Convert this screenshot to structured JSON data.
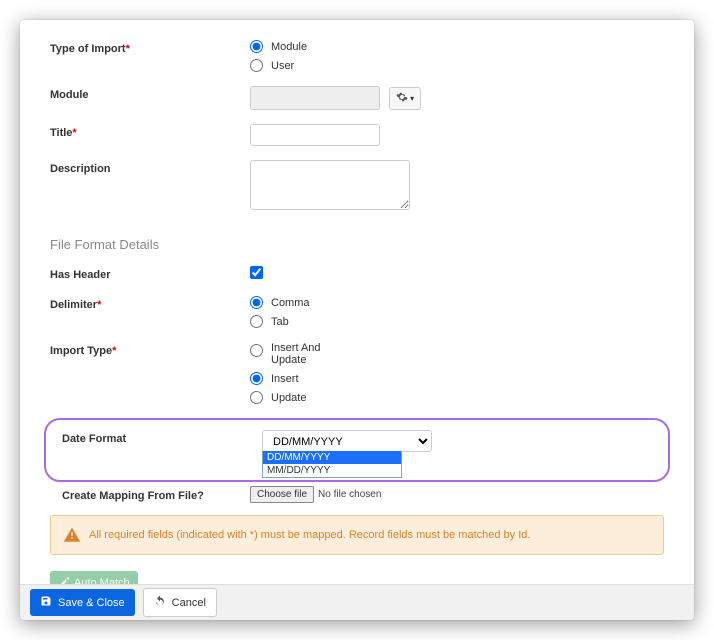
{
  "form": {
    "typeOfImport": {
      "label": "Type of Import",
      "required": true,
      "options": {
        "module": "Module",
        "user": "User"
      },
      "value": "module"
    },
    "module": {
      "label": "Module"
    },
    "title": {
      "label": "Title",
      "required": true,
      "value": ""
    },
    "description": {
      "label": "Description",
      "value": ""
    },
    "fileFormatHeader": "File Format Details",
    "hasHeader": {
      "label": "Has Header",
      "checked": true
    },
    "delimiter": {
      "label": "Delimiter",
      "required": true,
      "options": {
        "comma": "Comma",
        "tab": "Tab"
      },
      "value": "comma"
    },
    "importType": {
      "label": "Import Type",
      "required": true,
      "options": {
        "insertUpdate": "Insert And Update",
        "insert": "Insert",
        "update": "Update"
      },
      "value": "insert"
    },
    "dateFormat": {
      "label": "Date Format",
      "options": [
        "DD/MM/YYYY",
        "MM/DD/YYYY"
      ],
      "value": "DD/MM/YYYY"
    },
    "createMapping": {
      "label": "Create Mapping From File?",
      "fileButton": "Choose file",
      "noFile": "No file chosen"
    },
    "alert": "All required fields (indicated with *) must be mapped. Record fields must be matched by Id.",
    "autoMatch": "Auto Match"
  },
  "footer": {
    "save": "Save & Close",
    "cancel": "Cancel"
  },
  "colors": {
    "highlight": "#a86be0",
    "alertBg": "#fdeedc",
    "alertText": "#d9822b",
    "primary": "#0b66e0"
  }
}
